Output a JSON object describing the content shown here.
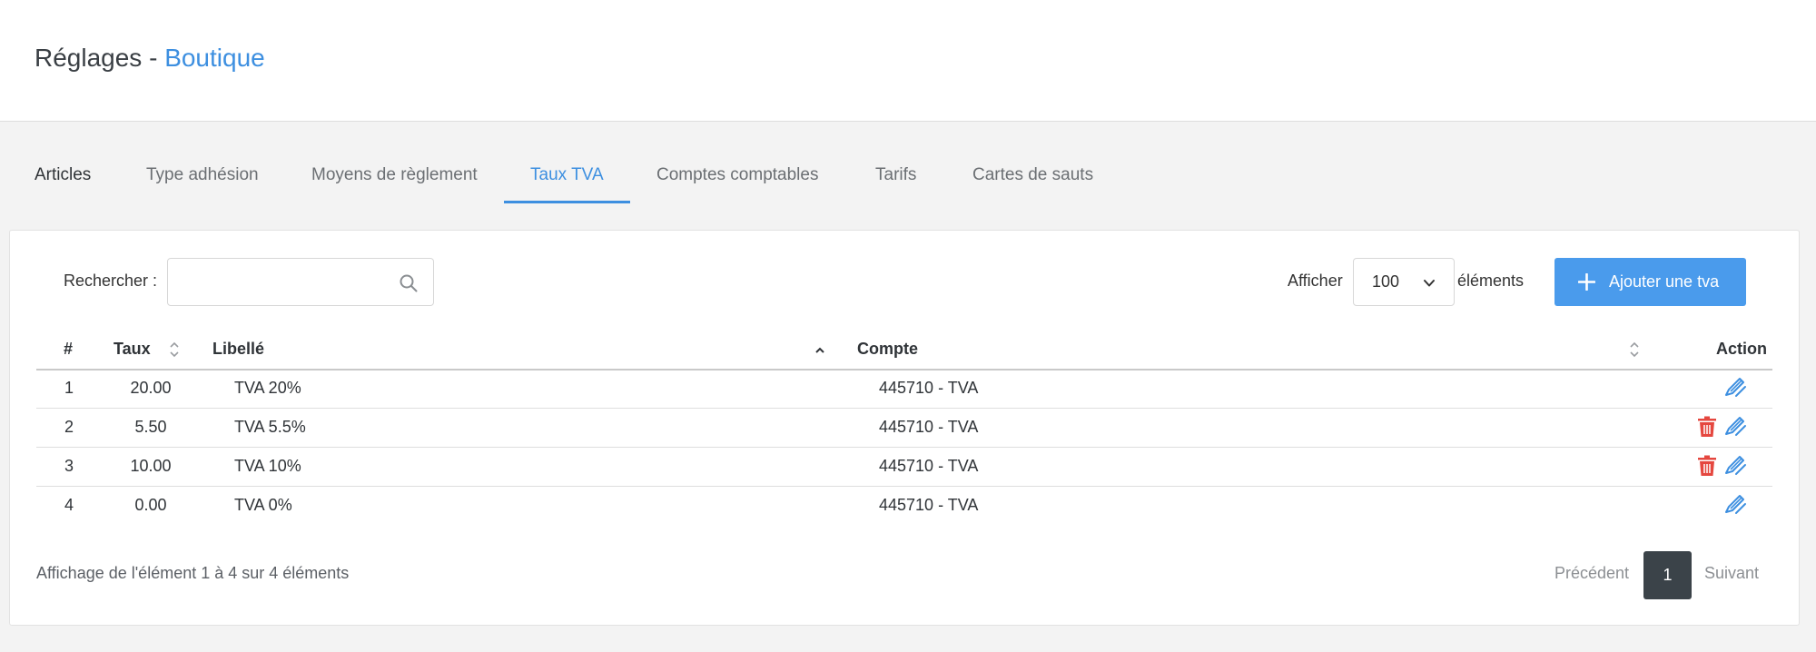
{
  "header": {
    "title_prefix": "Réglages - ",
    "title_accent": "Boutique"
  },
  "tabs": [
    {
      "label": "Articles",
      "active": false
    },
    {
      "label": "Type adhésion",
      "active": false
    },
    {
      "label": "Moyens de règlement",
      "active": false
    },
    {
      "label": "Taux TVA",
      "active": true
    },
    {
      "label": "Comptes comptables",
      "active": false
    },
    {
      "label": "Tarifs",
      "active": false
    },
    {
      "label": "Cartes de sauts",
      "active": false
    }
  ],
  "toolbar": {
    "search_label": "Rechercher :",
    "search_value": "",
    "show_label": "Afficher",
    "page_size": "100",
    "elements_label": "éléments",
    "add_button_label": "Ajouter une tva"
  },
  "table": {
    "columns": [
      "#",
      "Taux",
      "Libellé",
      "Compte",
      "Action"
    ],
    "rows": [
      {
        "num": "1",
        "taux": "20.00",
        "libelle": "TVA 20%",
        "compte": "445710 - TVA",
        "deletable": false
      },
      {
        "num": "2",
        "taux": "5.50",
        "libelle": "TVA 5.5%",
        "compte": "445710 - TVA",
        "deletable": true
      },
      {
        "num": "3",
        "taux": "10.00",
        "libelle": "TVA 10%",
        "compte": "445710 - TVA",
        "deletable": true
      },
      {
        "num": "4",
        "taux": "0.00",
        "libelle": "TVA 0%",
        "compte": "445710 - TVA",
        "deletable": false
      }
    ]
  },
  "footer": {
    "info": "Affichage de l'élément 1 à 4 sur 4 éléments",
    "prev": "Précédent",
    "current_page": "1",
    "next": "Suivant"
  },
  "colors": {
    "accent": "#3d8fe0",
    "button": "#4a9bec",
    "delete": "#e5473f",
    "active_page": "#3b4349"
  },
  "icons": [
    "search-icon",
    "chevron-down-icon",
    "plus-icon",
    "sort-icon",
    "sort-up-icon",
    "trash-icon",
    "edit-icon"
  ]
}
